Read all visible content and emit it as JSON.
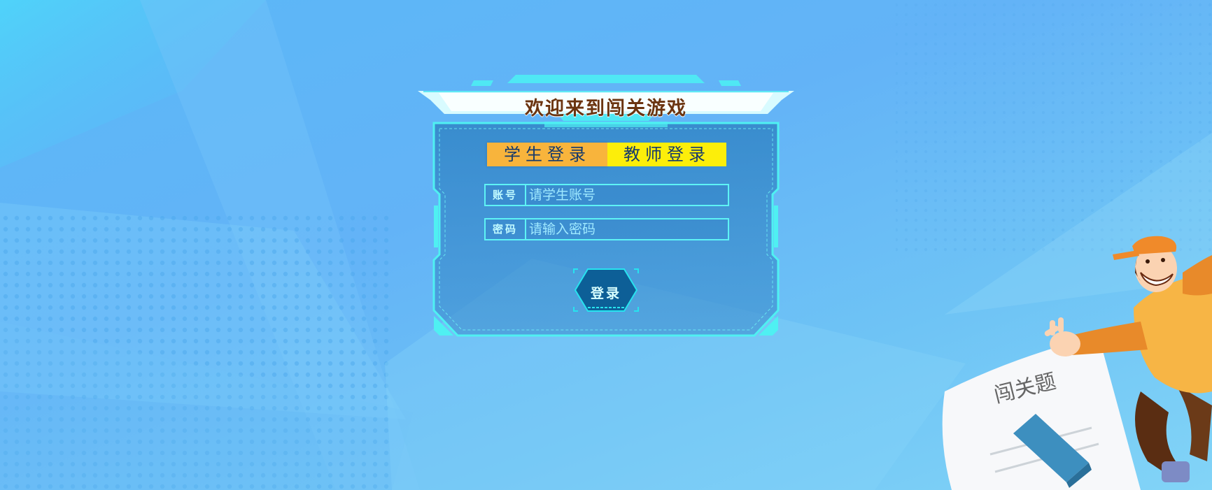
{
  "header": {
    "title": "欢迎来到闯关游戏"
  },
  "tabs": [
    {
      "label": "学生登录",
      "active": true
    },
    {
      "label": "教师登录",
      "active": false
    }
  ],
  "form": {
    "account": {
      "label": "账号",
      "placeholder": "请学生账号",
      "value": ""
    },
    "password": {
      "label": "密码",
      "placeholder": "请输入密码",
      "value": ""
    }
  },
  "login_button": {
    "label": "登录"
  },
  "illustration": {
    "sheet_text": "闯关题"
  },
  "colors": {
    "background": "#63b3f7",
    "panel_border": "#4ff0f2",
    "tab_student": "#f8b43c",
    "tab_teacher": "#fcee0a",
    "title_text": "#6b3410"
  }
}
